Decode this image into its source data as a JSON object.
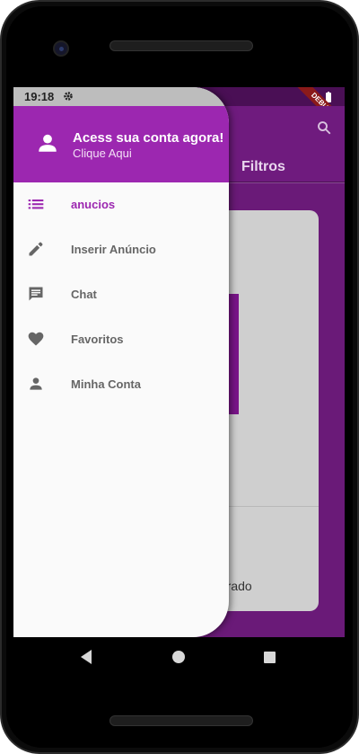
{
  "status": {
    "time": "19:18"
  },
  "appbar": {
    "tab_filters": "Filtros",
    "debug_banner": "DEBUG"
  },
  "card": {
    "text": "ntrado"
  },
  "drawer": {
    "header_title": "Acess sua conta agora!",
    "header_subtitle": "Clique Aqui",
    "items": [
      {
        "label": "anucios",
        "icon": "list-icon",
        "active": true
      },
      {
        "label": "Inserir Anúncio",
        "icon": "edit-icon"
      },
      {
        "label": "Chat",
        "icon": "chat-icon"
      },
      {
        "label": "Favoritos",
        "icon": "heart-icon"
      },
      {
        "label": "Minha Conta",
        "icon": "person-icon"
      }
    ]
  },
  "colors": {
    "primary": "#9c27b0",
    "appbar": "#6f1b7e",
    "drawer_bg": "#fafafa"
  }
}
